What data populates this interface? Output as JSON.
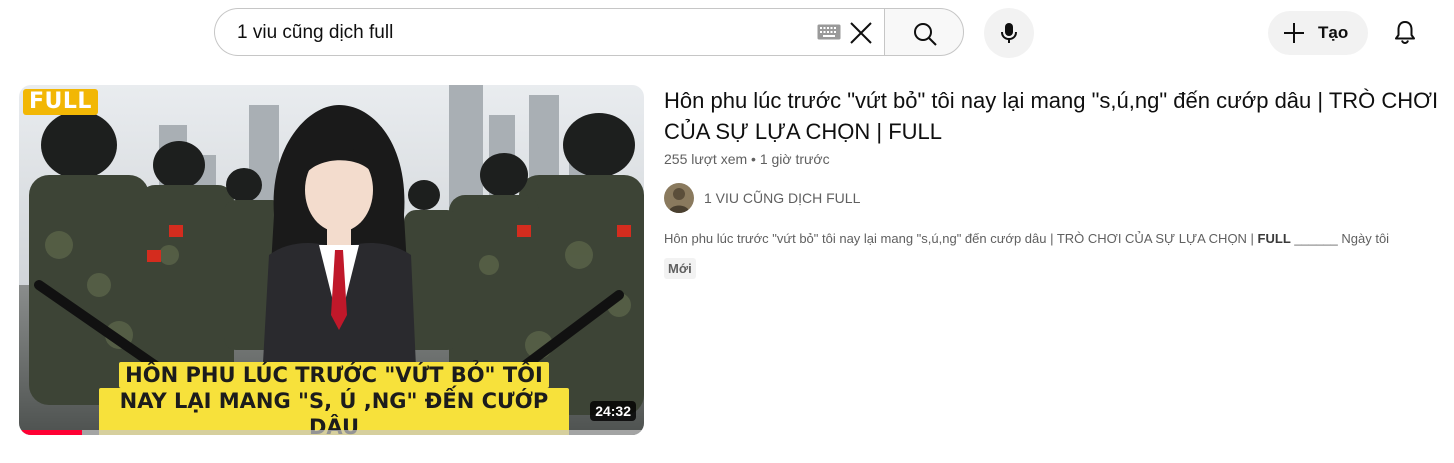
{
  "search": {
    "query": "1 viu cũng dịch full",
    "keyboard_icon": "keyboard-icon",
    "clear_icon": "close-icon",
    "search_icon": "search-icon",
    "mic_icon": "mic-icon"
  },
  "header": {
    "create_label": "Tạo",
    "create_icon": "plus-icon",
    "notifications_icon": "bell-icon"
  },
  "video": {
    "thumbnail": {
      "badge": "FULL",
      "caption_lines": [
        "HÔN PHU LÚC TRƯỚC \"VỨT BỎ\" TÔI",
        "NAY LẠI MANG \"S, Ú ,NG\" ĐẾN CƯỚP DÂU"
      ],
      "duration": "24:32",
      "watched_fraction": 0.1
    },
    "title": "Hôn phu lúc trước \"vứt bỏ\" tôi nay lại mang \"s,ú,ng\" đến cướp dâu | TRÒ CHƠI CỦA SỰ LỰA CHỌN | FULL",
    "views": "255 lượt xem",
    "separator": "•",
    "age": "1 giờ trước",
    "channel": "1 VIU CŨNG DỊCH FULL",
    "description_prefix": "Hôn phu lúc trước \"vứt bỏ\" tôi nay lại mang \"s,ú,ng\" đến cướp dâu | TRÒ CHƠI CỦA SỰ LỰA CHỌN | ",
    "description_bold": "FULL",
    "description_suffix": " ______ Ngày tôi",
    "badge_new": "Mới"
  },
  "colors": {
    "accent": "#ff0033",
    "caption_bg": "#f7e13b",
    "badge_bg": "#f2b705"
  }
}
